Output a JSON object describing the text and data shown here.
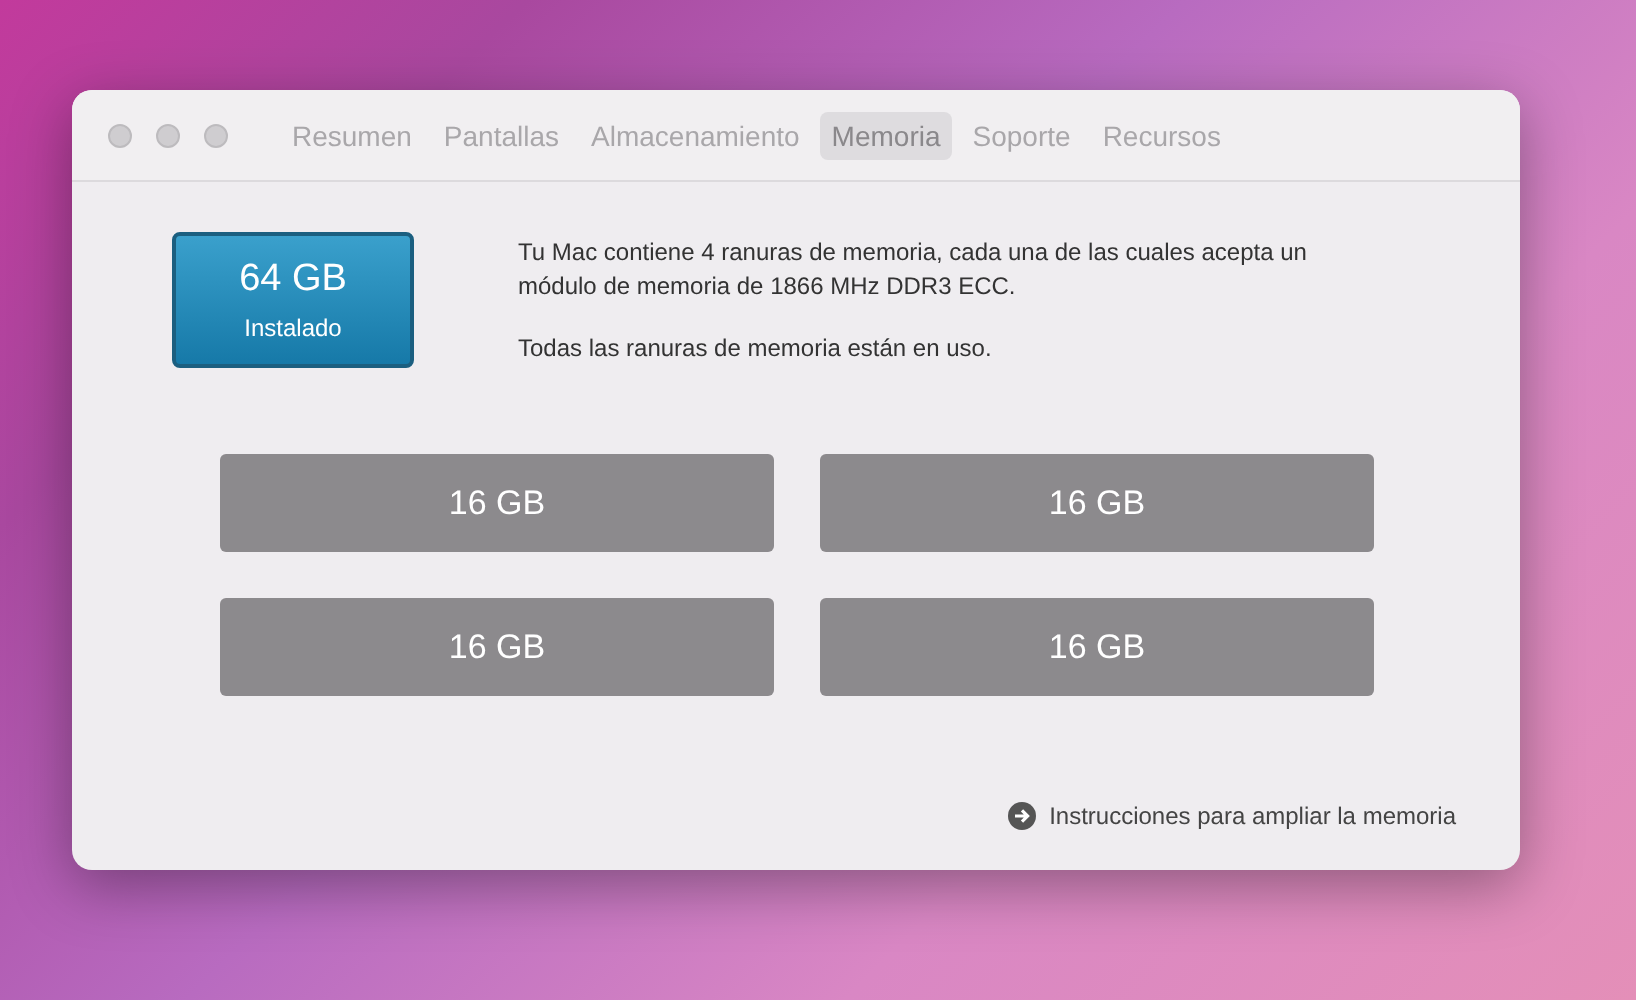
{
  "window": {
    "tabs": [
      {
        "label": "Resumen",
        "selected": false
      },
      {
        "label": "Pantallas",
        "selected": false
      },
      {
        "label": "Almacenamiento",
        "selected": false
      },
      {
        "label": "Memoria",
        "selected": true
      },
      {
        "label": "Soporte",
        "selected": false
      },
      {
        "label": "Recursos",
        "selected": false
      }
    ]
  },
  "installed": {
    "amount": "64 GB",
    "label": "Instalado"
  },
  "description": [
    "Tu Mac contiene 4 ranuras de memoria, cada una de las cuales acepta un módulo de memoria de 1866 MHz DDR3 ECC.",
    "Todas las ranuras de memoria están en uso."
  ],
  "slots": [
    {
      "label": "16 GB"
    },
    {
      "label": "16 GB"
    },
    {
      "label": "16 GB"
    },
    {
      "label": "16 GB"
    }
  ],
  "link": "Instrucciones para ampliar la memoria"
}
